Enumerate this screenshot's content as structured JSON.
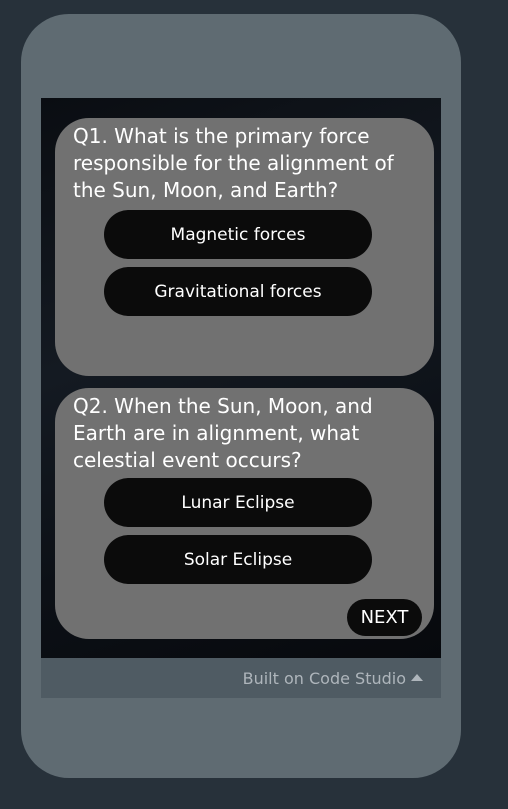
{
  "quiz": {
    "questions": [
      {
        "text": "Q1. What is the primary force responsible for the alignment of the Sun, Moon, and Earth?",
        "answers": [
          "Magnetic forces",
          "Gravitational forces"
        ]
      },
      {
        "text": "Q2. When the Sun, Moon, and Earth are in alignment, what celestial event occurs?",
        "answers": [
          "Lunar Eclipse",
          "Solar Eclipse"
        ]
      }
    ],
    "next_label": "NEXT"
  },
  "footer": {
    "label": "Built on Code Studio",
    "icon": "caret-up-icon"
  },
  "colors": {
    "page_background": "#27313a",
    "device_frame": "#5f6b72",
    "card": "#717171",
    "button": "#0b0b0b",
    "footer": "#4f5b63",
    "footer_text": "#aeb5bb"
  }
}
